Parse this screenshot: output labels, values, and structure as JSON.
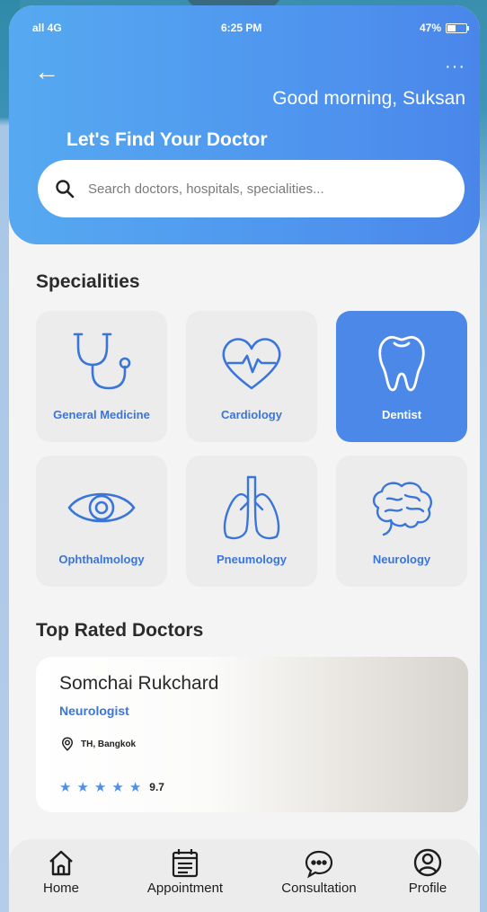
{
  "status_bar": {
    "signal": "all 4G",
    "time": "6:25 PM",
    "battery": "47%"
  },
  "header": {
    "greeting": "Good morning, Suksan",
    "subtitle": "Let's Find Your Doctor",
    "search": {
      "placeholder": "Search doctors, hospitals, specialities..."
    }
  },
  "specialities": {
    "title": "Specialities",
    "items": [
      {
        "label": "General Medicine",
        "icon": "stethoscope-icon"
      },
      {
        "label": "Cardiology",
        "icon": "heart-icon"
      },
      {
        "label": "Dentist",
        "icon": "tooth-icon",
        "selected": true
      },
      {
        "label": "Ophthalmology",
        "icon": "eye-icon"
      },
      {
        "label": "Pneumology",
        "icon": "lungs-icon"
      },
      {
        "label": "Neurology",
        "icon": "brain-icon"
      }
    ]
  },
  "top_rated": {
    "title": "Top Rated Doctors",
    "doctor": {
      "name": "Somchai Rukchard",
      "speciality": "Neurologist",
      "location": "TH, Bangkok",
      "stars": 5,
      "rating": "9.7"
    }
  },
  "tabbar": {
    "items": [
      {
        "label": "Home",
        "icon": "home-icon"
      },
      {
        "label": "Appointment",
        "icon": "calendar-icon"
      },
      {
        "label": "Consultation",
        "icon": "chat-icon"
      },
      {
        "label": "Profile",
        "icon": "profile-icon"
      }
    ]
  },
  "colors": {
    "accent": "#4c88e8",
    "label_blue": "#3a75d9",
    "card_bg": "#ececec"
  }
}
